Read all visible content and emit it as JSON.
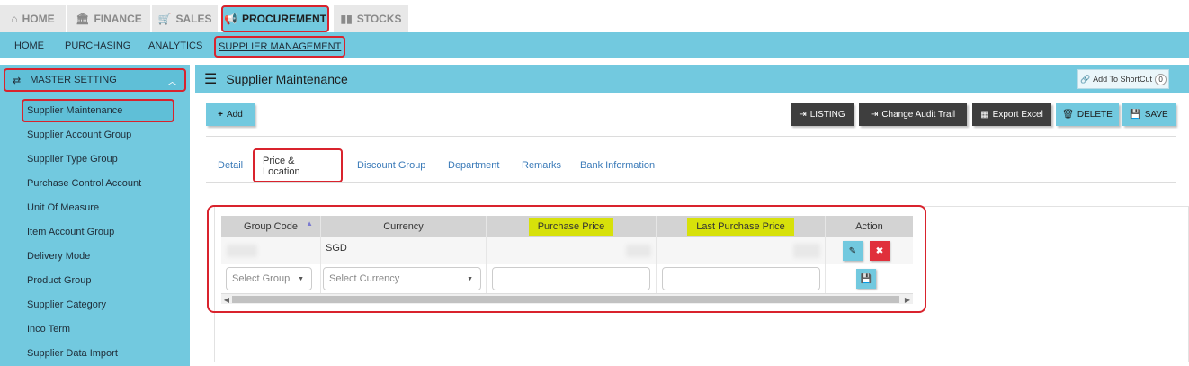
{
  "top_tabs": [
    {
      "label": "HOME",
      "icon": "home-icon"
    },
    {
      "label": "FINANCE",
      "icon": "bank-icon"
    },
    {
      "label": "SALES",
      "icon": "cart-icon"
    },
    {
      "label": "PROCUREMENT",
      "icon": "megaphone-icon"
    },
    {
      "label": "STOCKS",
      "icon": "bar-chart-icon"
    }
  ],
  "sub_nav": [
    "HOME",
    "PURCHASING",
    "ANALYTICS",
    "SUPPLIER MANAGEMENT"
  ],
  "sidebar": {
    "header": "MASTER SETTING",
    "items": [
      "Supplier Maintenance",
      "Supplier Account Group",
      "Supplier Type Group",
      "Purchase Control Account",
      "Unit Of Measure",
      "Item Account Group",
      "Delivery Mode",
      "Product Group",
      "Supplier Category",
      "Inco Term",
      "Supplier Data Import"
    ]
  },
  "panel": {
    "title": "Supplier Maintenance",
    "shortcut_label": "Add To ShortCut",
    "shortcut_count": "0"
  },
  "toolbar": {
    "add": "Add",
    "listing": "LISTING",
    "audit": "Change Audit Trail",
    "export": "Export Excel",
    "delete": "DELETE",
    "save": "SAVE"
  },
  "tabs": [
    "Detail",
    "Price & Location",
    "Discount Group",
    "Department",
    "Remarks",
    "Bank Information"
  ],
  "grid": {
    "columns": [
      "Group Code",
      "Currency",
      "Purchase Price",
      "Last Purchase Price",
      "Action"
    ],
    "row1_currency": "SGD",
    "select_group_placeholder": "Select Group",
    "select_currency_placeholder": "Select Currency"
  },
  "colors": {
    "accent": "#72c9df",
    "highlight": "#d7e10a",
    "annotation": "#d9232d"
  }
}
